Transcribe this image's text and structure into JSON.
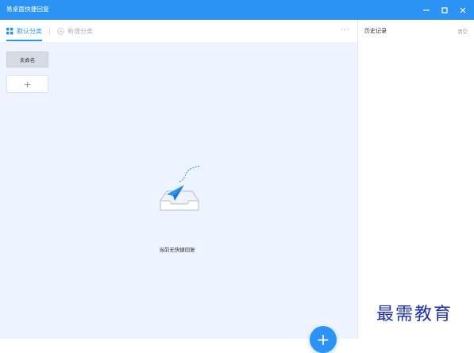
{
  "window": {
    "title": "易桌面快捷回复"
  },
  "tabs": [
    {
      "label": "默认分类",
      "active": true,
      "icon": "grid-icon"
    },
    {
      "label": "新增分类",
      "active": false,
      "icon": "plus-circle-icon"
    }
  ],
  "toolbar": {
    "more_label": "···"
  },
  "categories": [
    {
      "label": "未命名"
    }
  ],
  "add_category_label": "+",
  "empty_state": {
    "text": "当前无快捷回复",
    "icon": "paper-plane-inbox-icon"
  },
  "fab_label": "+",
  "history": {
    "title": "历史记录",
    "clear_label": "清空"
  },
  "watermark": "最需教育",
  "colors": {
    "accent": "#2b93f3",
    "content_bg": "#eef4ff",
    "watermark": "#1f2fa8"
  }
}
